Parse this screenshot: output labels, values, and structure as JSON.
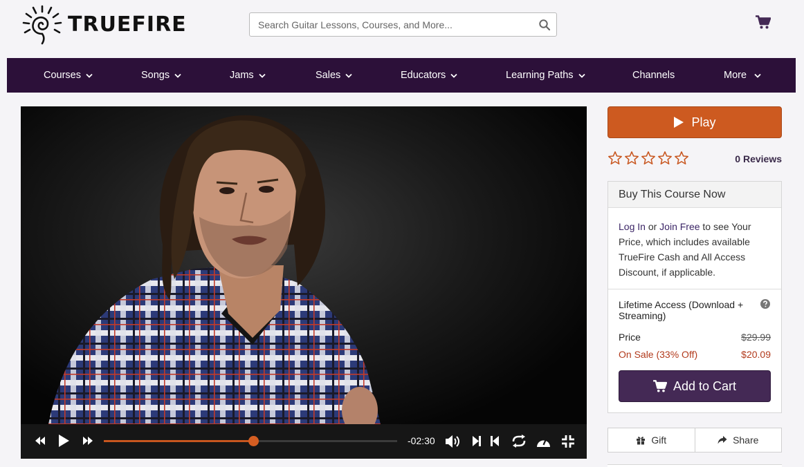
{
  "brand": {
    "name": "TRUEFIRE"
  },
  "search": {
    "placeholder": "Search Guitar Lessons, Courses, and More..."
  },
  "nav": {
    "items": [
      {
        "label": "Courses",
        "has_dropdown": true
      },
      {
        "label": "Songs",
        "has_dropdown": true
      },
      {
        "label": "Jams",
        "has_dropdown": true
      },
      {
        "label": "Sales",
        "has_dropdown": true
      },
      {
        "label": "Educators",
        "has_dropdown": true
      },
      {
        "label": "Learning Paths",
        "has_dropdown": true
      },
      {
        "label": "Channels",
        "has_dropdown": false
      },
      {
        "label": "More",
        "has_dropdown": true
      }
    ]
  },
  "player": {
    "time_remaining": "-02:30",
    "progress_percent": 51,
    "controls": [
      "rewind-icon",
      "play-icon",
      "fast-forward-icon",
      "volume-icon",
      "next-icon",
      "previous-icon",
      "loop-icon",
      "speed-icon",
      "exit-fullscreen-icon"
    ]
  },
  "sidebar": {
    "play_label": "Play",
    "rating": {
      "stars_filled": 0,
      "stars_total": 5
    },
    "reviews_label": "0 Reviews",
    "buy": {
      "heading": "Buy This Course Now",
      "login_link": "Log In",
      "or_text": " or ",
      "join_link": "Join Free",
      "info_text": " to see Your Price, which includes available TrueFire Cash and All Access Discount, if applicable.",
      "access_label": "Lifetime Access (Download + Streaming)",
      "price_label": "Price",
      "price_original": "$29.99",
      "sale_label": "On Sale (33% Off)",
      "sale_price": "$20.09",
      "add_to_cart_label": "Add to Cart"
    },
    "gift_label": "Gift",
    "share_label": "Share"
  },
  "colors": {
    "nav_bg": "#2c1039",
    "play_orange": "#cd5a20",
    "cart_purple": "#442955",
    "sale_red": "#b23a1c",
    "star_outline": "#c8561f"
  }
}
